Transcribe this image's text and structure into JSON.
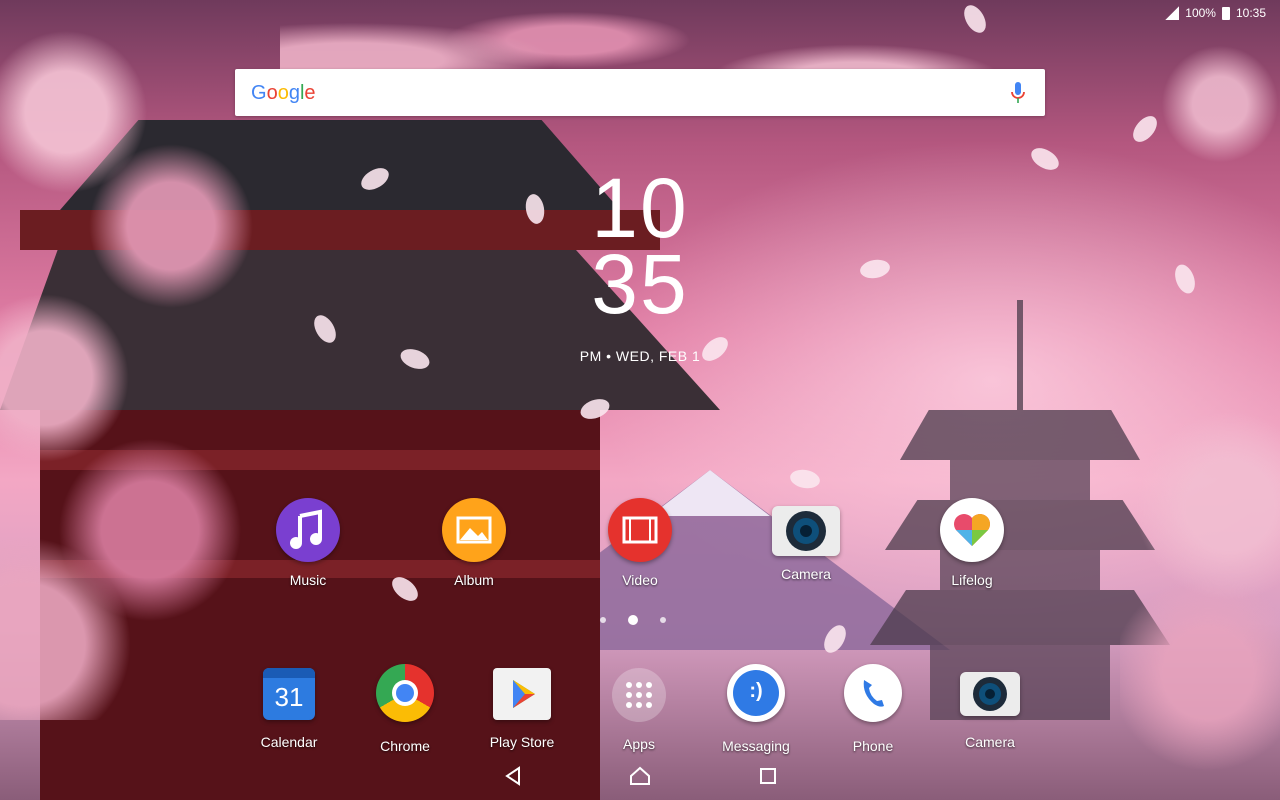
{
  "status_bar": {
    "battery": "100%",
    "time": "10:35",
    "icons": [
      "signal-icon",
      "battery-icon"
    ]
  },
  "search": {
    "logo": "Google",
    "mic_icon": "mic-icon"
  },
  "clock": {
    "hour": "10",
    "minute": "35",
    "date": "PM • WED, FEB 1"
  },
  "workspace_apps": [
    {
      "label": "Music",
      "icon": "music-icon",
      "color": "#7a3fd0"
    },
    {
      "label": "Album",
      "icon": "album-icon",
      "color": "#ffa31a"
    },
    {
      "label": "Video",
      "icon": "video-icon",
      "color": "#e5322d"
    },
    {
      "label": "Camera",
      "icon": "camera-icon",
      "color": "#ececec"
    },
    {
      "label": "Lifelog",
      "icon": "lifelog-icon",
      "color": "#ffffff"
    }
  ],
  "page_indicator": {
    "pages": 3,
    "active": 2
  },
  "dock_apps": [
    {
      "label": "Calendar",
      "icon": "calendar-icon",
      "day": "31",
      "color": "#2d7be0"
    },
    {
      "label": "Chrome",
      "icon": "chrome-icon",
      "color": "#e5322d"
    },
    {
      "label": "Play Store",
      "icon": "play-store-icon",
      "color": "#f2f2f2"
    },
    {
      "label": "Apps",
      "icon": "apps-drawer-icon",
      "color": "#ffffff"
    },
    {
      "label": "Messaging",
      "icon": "messaging-icon",
      "color": "#2f7ae5"
    },
    {
      "label": "Phone",
      "icon": "phone-icon",
      "color": "#ffffff"
    },
    {
      "label": "Camera",
      "icon": "camera-icon",
      "color": "#ececec"
    }
  ],
  "nav": {
    "back": "back-icon",
    "home": "home-icon",
    "recents": "recents-icon"
  }
}
